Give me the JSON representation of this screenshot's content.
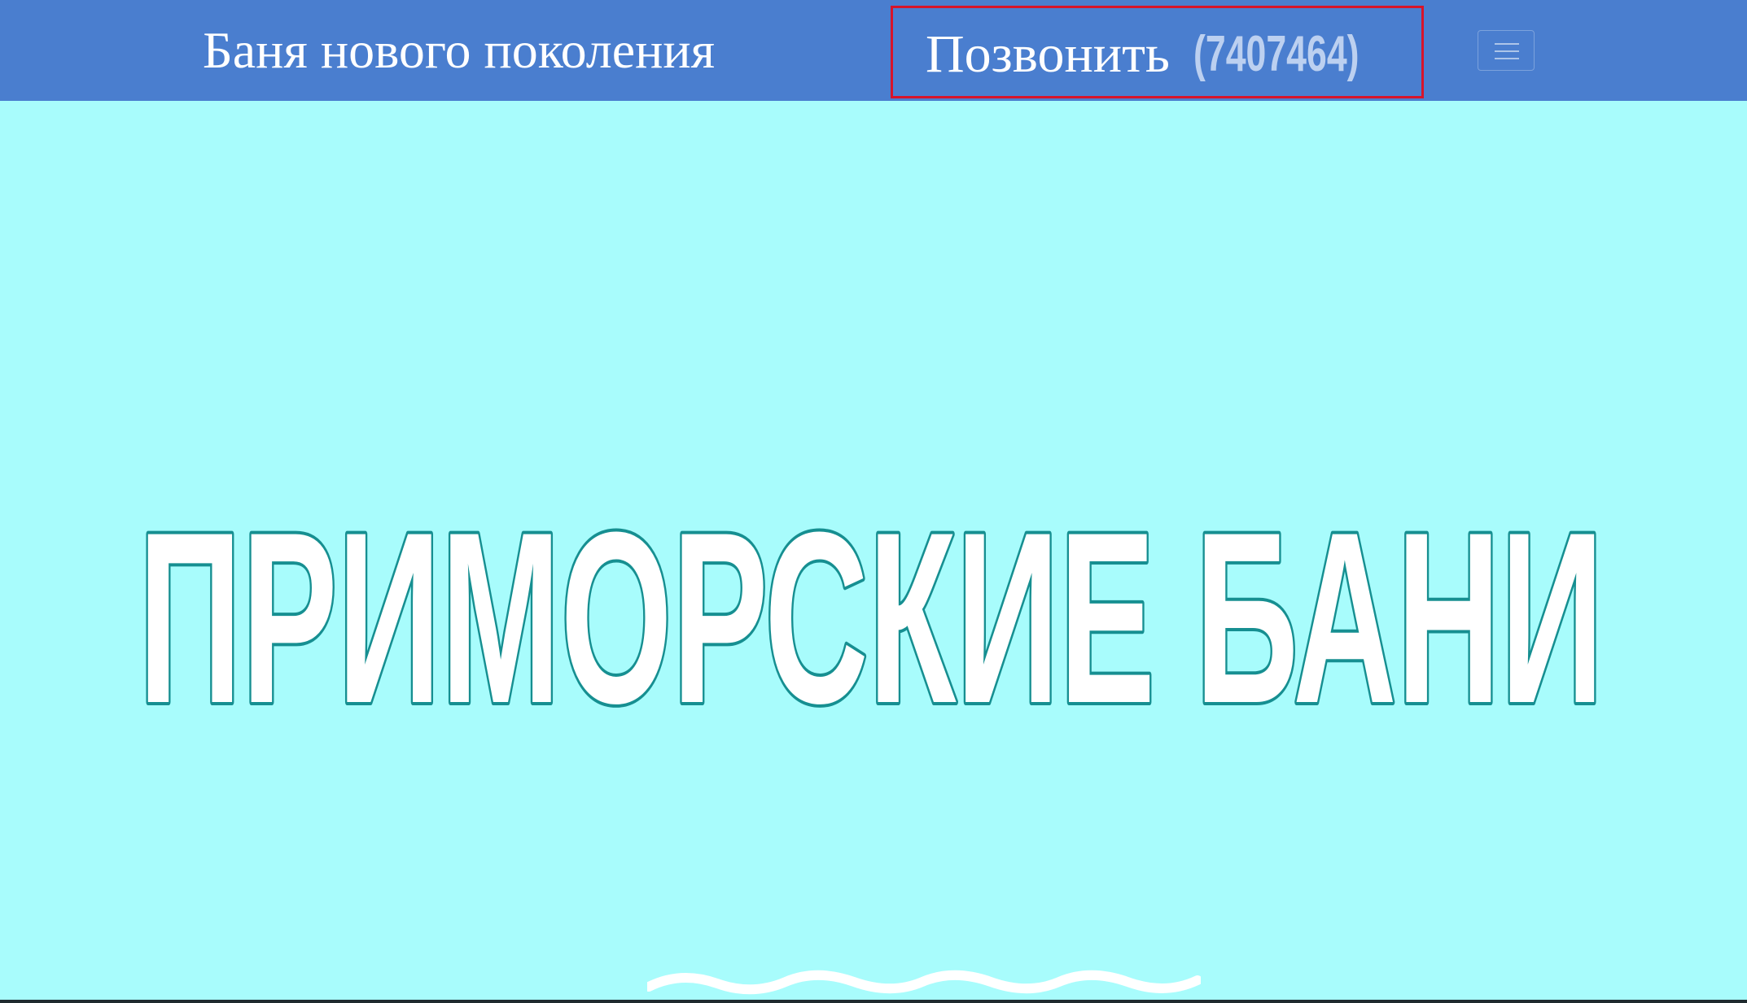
{
  "navbar": {
    "brand": "Баня нового поколения",
    "call_label": "Позвонить",
    "call_number": "(7407464)",
    "menu_icon": "hamburger-icon"
  },
  "hero": {
    "title": "ПРИМОРСКИЕ БАНИ",
    "decoration_icon": "wave-icon"
  },
  "colors": {
    "navbar_bg": "#4a7ecf",
    "page_bg": "#a8fcfc",
    "title_stroke": "#168f91",
    "title_fill": "#ffffff",
    "highlight_border": "#d7142a",
    "number_color": "#bcd0f0"
  }
}
